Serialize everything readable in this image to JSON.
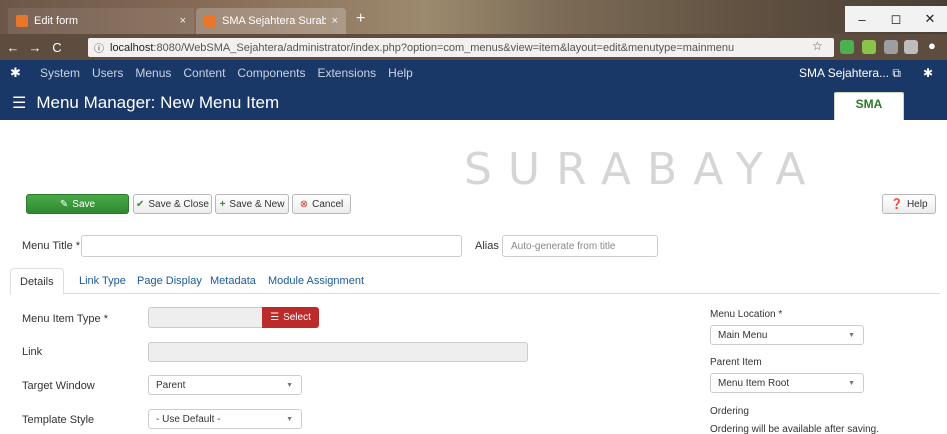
{
  "browser": {
    "tabs": [
      {
        "label": "Edit form",
        "close": "×"
      },
      {
        "label": "SMA Sejahtera Surabaya - Admi",
        "close": "×"
      }
    ],
    "new_tab": "+",
    "window_controls": [
      "–",
      "◻",
      "✕"
    ],
    "url": {
      "host": "localhost",
      "rest": ":8080/WebSMA_Sejahtera/administrator/index.php?option=com_menus&view=item&layout=edit&menutype=mainmenu"
    }
  },
  "adminbar": {
    "menu": [
      "System",
      "Users",
      "Menus",
      "Content",
      "Components",
      "Extensions",
      "Help"
    ],
    "site": "SMA Sejahtera..."
  },
  "header": {
    "title": "Menu Manager: New Menu Item",
    "logo_text": "SMA"
  },
  "watermark": "SURABAYA",
  "toolbar": {
    "save": "Save",
    "save_close": "Save & Close",
    "save_new": "Save & New",
    "cancel": "Cancel",
    "help": "Help"
  },
  "form": {
    "menu_title_label": "Menu Title *",
    "menu_title_value": "",
    "alias_label": "Alias",
    "alias_placeholder": "Auto-generate from title"
  },
  "tabs": [
    "Details",
    "Link Type",
    "Page Display",
    "Metadata",
    "Module Assignment"
  ],
  "details": {
    "menu_item_type_label": "Menu Item Type *",
    "select_button": "Select",
    "link_label": "Link",
    "target_window_label": "Target Window",
    "target_window_value": "Parent",
    "template_style_label": "Template Style",
    "template_style_value": "- Use Default -"
  },
  "sidebar": {
    "menu_location_label": "Menu Location *",
    "menu_location_value": "Main Menu",
    "parent_item_label": "Parent Item",
    "parent_item_value": "Menu Item Root",
    "ordering_label": "Ordering",
    "ordering_note": "Ordering will be available after saving."
  }
}
